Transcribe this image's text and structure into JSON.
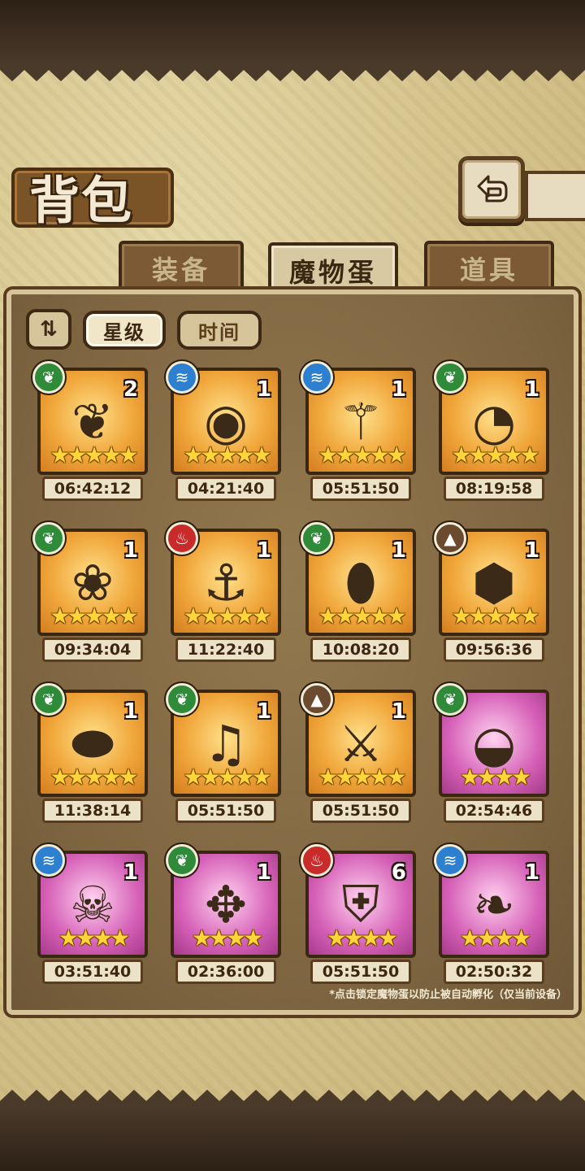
{
  "title": "背包",
  "back_icon": "back-arrow-icon",
  "tabs": [
    {
      "label": "装备",
      "active": false
    },
    {
      "label": "魔物蛋",
      "active": true
    },
    {
      "label": "道具",
      "active": false
    }
  ],
  "sort": {
    "order_icon": "sort-order-icon",
    "options": [
      {
        "label": "星级",
        "active": true
      },
      {
        "label": "时间",
        "active": false
      }
    ]
  },
  "element_colors": {
    "leaf": "#2f8a3a",
    "water": "#2d7fcf",
    "fire": "#c92a2a",
    "earth": "#6b4a2f"
  },
  "eggs": [
    {
      "element": "leaf",
      "count": "2",
      "stars": 5,
      "rarity": "orange",
      "timer": "06:42:12",
      "icon": "sprout-creature-icon"
    },
    {
      "element": "water",
      "count": "1",
      "stars": 5,
      "rarity": "orange",
      "timer": "04:21:40",
      "icon": "eye-spider-icon"
    },
    {
      "element": "water",
      "count": "1",
      "stars": 5,
      "rarity": "orange",
      "timer": "05:51:50",
      "icon": "staff-icon"
    },
    {
      "element": "leaf",
      "count": "1",
      "stars": 5,
      "rarity": "orange",
      "timer": "08:19:58",
      "icon": "pocket-watch-icon"
    },
    {
      "element": "leaf",
      "count": "1",
      "stars": 5,
      "rarity": "orange",
      "timer": "09:34:04",
      "icon": "pink-blob-icon"
    },
    {
      "element": "fire",
      "count": "1",
      "stars": 5,
      "rarity": "orange",
      "timer": "11:22:40",
      "icon": "pirate-hat-icon"
    },
    {
      "element": "leaf",
      "count": "1",
      "stars": 5,
      "rarity": "orange",
      "timer": "10:08:20",
      "icon": "crystal-egg-icon"
    },
    {
      "element": "earth",
      "count": "1",
      "stars": 5,
      "rarity": "orange",
      "timer": "09:56:36",
      "icon": "rock-egg-icon"
    },
    {
      "element": "leaf",
      "count": "1",
      "stars": 5,
      "rarity": "orange",
      "timer": "11:38:14",
      "icon": "melon-egg-icon"
    },
    {
      "element": "leaf",
      "count": "1",
      "stars": 5,
      "rarity": "orange",
      "timer": "05:51:50",
      "icon": "lyre-icon"
    },
    {
      "element": "earth",
      "count": "1",
      "stars": 5,
      "rarity": "orange",
      "timer": "05:51:50",
      "icon": "sword-icon"
    },
    {
      "element": "leaf",
      "count": "",
      "stars": 4,
      "rarity": "purple",
      "timer": "02:54:46",
      "icon": "striped-egg-icon"
    },
    {
      "element": "water",
      "count": "1",
      "stars": 4,
      "rarity": "purple",
      "timer": "03:51:40",
      "icon": "skull-bunny-icon"
    },
    {
      "element": "leaf",
      "count": "1",
      "stars": 4,
      "rarity": "purple",
      "timer": "02:36:00",
      "icon": "winged-egg-icon"
    },
    {
      "element": "fire",
      "count": "6",
      "stars": 4,
      "rarity": "purple",
      "timer": "05:51:50",
      "icon": "shield-icon"
    },
    {
      "element": "water",
      "count": "1",
      "stars": 4,
      "rarity": "purple",
      "timer": "02:50:32",
      "icon": "leaf-egg-icon"
    }
  ],
  "hint": "*点击锁定魔物蛋以防止被自动孵化（仅当前设备）"
}
